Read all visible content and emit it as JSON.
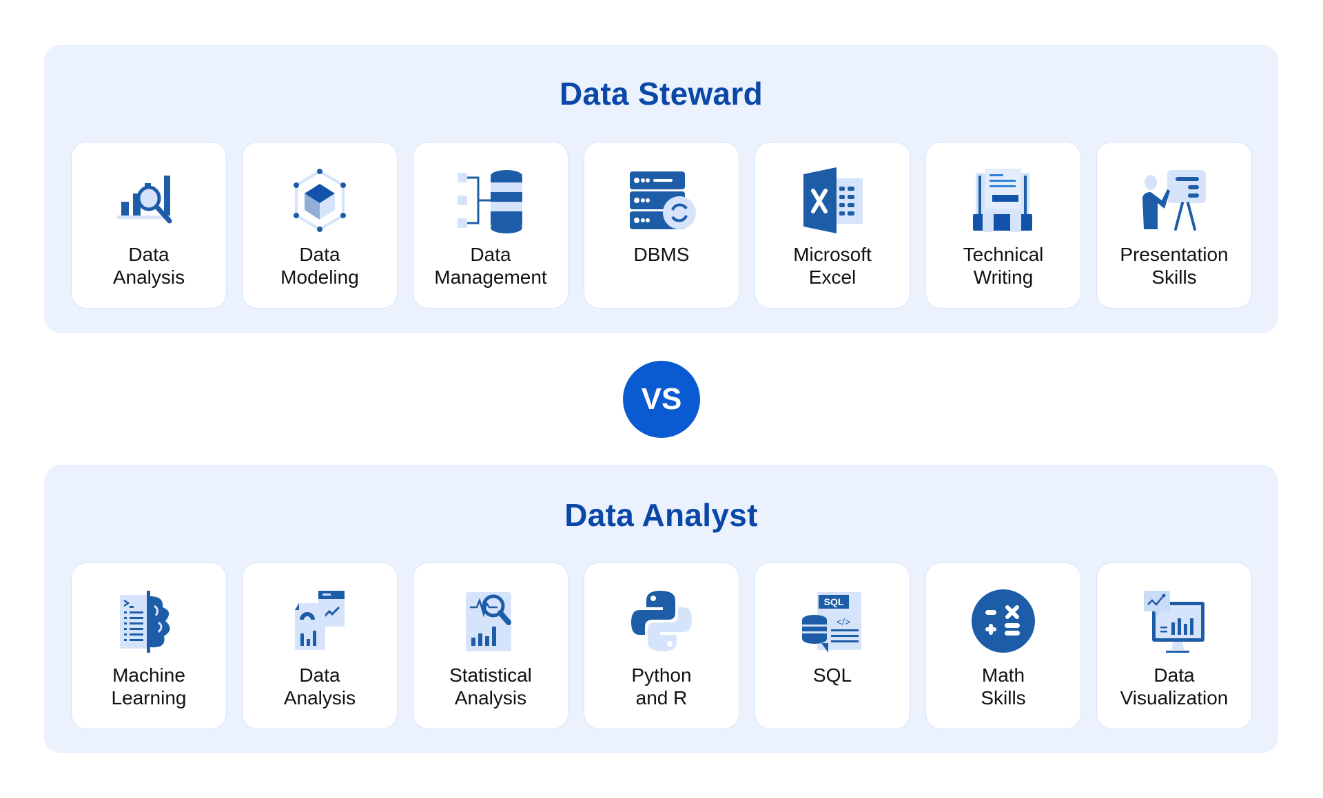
{
  "colors": {
    "panel_bg": "#ebf2fe",
    "title": "#0a47a6",
    "icon_primary": "#1d5ca7",
    "icon_light": "#d6e4fb",
    "vs_bg": "#0a5bd1"
  },
  "steward": {
    "title": "Data Steward",
    "cards": [
      {
        "icon": "data-analysis-icon",
        "line1": "Data",
        "line2": "Analysis"
      },
      {
        "icon": "data-modeling-icon",
        "line1": "Data",
        "line2": "Modeling"
      },
      {
        "icon": "data-management-icon",
        "line1": "Data",
        "line2": "Management"
      },
      {
        "icon": "dbms-icon",
        "line1": "DBMS",
        "line2": ""
      },
      {
        "icon": "microsoft-excel-icon",
        "line1": "Microsoft",
        "line2": "Excel"
      },
      {
        "icon": "technical-writing-icon",
        "line1": "Technical",
        "line2": "Writing"
      },
      {
        "icon": "presentation-icon",
        "line1": "Presentation",
        "line2": "Skills"
      }
    ]
  },
  "vs_label": "VS",
  "analyst": {
    "title": "Data Analyst",
    "cards": [
      {
        "icon": "machine-learning-icon",
        "line1": "Machine",
        "line2": "Learning"
      },
      {
        "icon": "data-analysis-report-icon",
        "line1": "Data",
        "line2": "Analysis"
      },
      {
        "icon": "statistical-analysis-icon",
        "line1": "Statistical",
        "line2": "Analysis"
      },
      {
        "icon": "python-icon",
        "line1": "Python",
        "line2": "and R"
      },
      {
        "icon": "sql-icon",
        "line1": "SQL",
        "line2": ""
      },
      {
        "icon": "math-icon",
        "line1": "Math",
        "line2": "Skills"
      },
      {
        "icon": "data-visualization-icon",
        "line1": "Data",
        "line2": "Visualization"
      }
    ]
  }
}
